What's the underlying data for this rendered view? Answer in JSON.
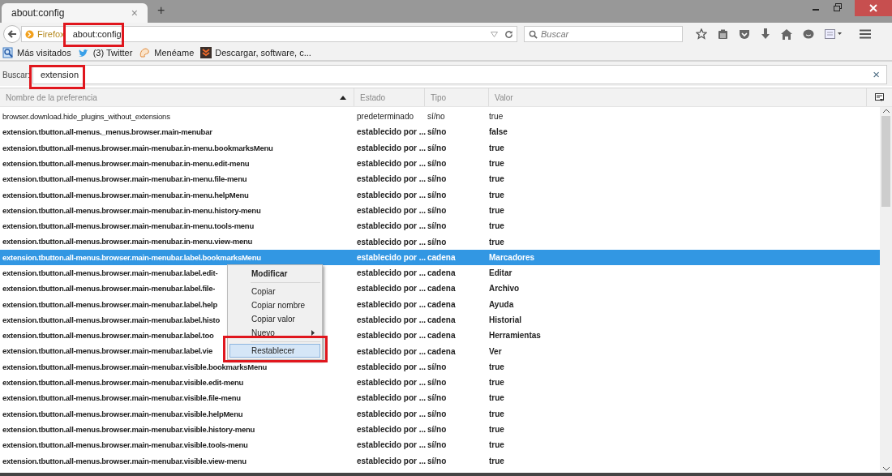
{
  "tab": {
    "title": "about:config",
    "close": "×",
    "new": "+"
  },
  "nav": {
    "identity": "Firefox",
    "url": "about:config",
    "search_placeholder": "Buscar"
  },
  "bookmarks": [
    {
      "label": "Más visitados",
      "kind": "mag"
    },
    {
      "label": "(3) Twitter",
      "kind": "bird"
    },
    {
      "label": "Menéame",
      "kind": "meneame"
    },
    {
      "label": "Descargar, software, c...",
      "kind": "download"
    }
  ],
  "filter": {
    "label": "Buscar:",
    "value": "extension",
    "clear": "×"
  },
  "table": {
    "columns": [
      {
        "label": "Nombre de la preferencia",
        "sorted": true
      },
      {
        "label": "Estado",
        "sorted": false
      },
      {
        "label": "Tipo",
        "sorted": false
      },
      {
        "label": "Valor",
        "sorted": false
      }
    ],
    "rows": [
      {
        "name": "browser.download.hide_plugins_without_extensions",
        "status": "predeterminado",
        "type": "sí/no",
        "value": "true",
        "modified": false,
        "selected": false
      },
      {
        "name": "extension.tbutton.all-menus._menus.browser.main-menubar",
        "status": "establecido por ...",
        "type": "sí/no",
        "value": "false",
        "modified": true,
        "selected": false
      },
      {
        "name": "extension.tbutton.all-menus.browser.main-menubar.in-menu.bookmarksMenu",
        "status": "establecido por ...",
        "type": "sí/no",
        "value": "true",
        "modified": true,
        "selected": false
      },
      {
        "name": "extension.tbutton.all-menus.browser.main-menubar.in-menu.edit-menu",
        "status": "establecido por ...",
        "type": "sí/no",
        "value": "true",
        "modified": true,
        "selected": false
      },
      {
        "name": "extension.tbutton.all-menus.browser.main-menubar.in-menu.file-menu",
        "status": "establecido por ...",
        "type": "sí/no",
        "value": "true",
        "modified": true,
        "selected": false
      },
      {
        "name": "extension.tbutton.all-menus.browser.main-menubar.in-menu.helpMenu",
        "status": "establecido por ...",
        "type": "sí/no",
        "value": "true",
        "modified": true,
        "selected": false
      },
      {
        "name": "extension.tbutton.all-menus.browser.main-menubar.in-menu.history-menu",
        "status": "establecido por ...",
        "type": "sí/no",
        "value": "true",
        "modified": true,
        "selected": false
      },
      {
        "name": "extension.tbutton.all-menus.browser.main-menubar.in-menu.tools-menu",
        "status": "establecido por ...",
        "type": "sí/no",
        "value": "true",
        "modified": true,
        "selected": false
      },
      {
        "name": "extension.tbutton.all-menus.browser.main-menubar.in-menu.view-menu",
        "status": "establecido por ...",
        "type": "sí/no",
        "value": "true",
        "modified": true,
        "selected": false
      },
      {
        "name": "extension.tbutton.all-menus.browser.main-menubar.label.bookmarksMenu",
        "status": "establecido por ...",
        "type": "cadena",
        "value": "Marcadores",
        "modified": true,
        "selected": true
      },
      {
        "name": "extension.tbutton.all-menus.browser.main-menubar.label.edit-",
        "status": "establecido por ...",
        "type": "cadena",
        "value": "Editar",
        "modified": true,
        "selected": false
      },
      {
        "name": "extension.tbutton.all-menus.browser.main-menubar.label.file-",
        "status": "establecido por ...",
        "type": "cadena",
        "value": "Archivo",
        "modified": true,
        "selected": false
      },
      {
        "name": "extension.tbutton.all-menus.browser.main-menubar.label.help",
        "status": "establecido por ...",
        "type": "cadena",
        "value": "Ayuda",
        "modified": true,
        "selected": false
      },
      {
        "name": "extension.tbutton.all-menus.browser.main-menubar.label.histo",
        "status": "establecido por ...",
        "type": "cadena",
        "value": "Historial",
        "modified": true,
        "selected": false
      },
      {
        "name": "extension.tbutton.all-menus.browser.main-menubar.label.too",
        "status": "establecido por ...",
        "type": "cadena",
        "value": "Herramientas",
        "modified": true,
        "selected": false
      },
      {
        "name": "extension.tbutton.all-menus.browser.main-menubar.label.vie",
        "status": "establecido por ...",
        "type": "cadena",
        "value": "Ver",
        "modified": true,
        "selected": false
      },
      {
        "name": "extension.tbutton.all-menus.browser.main-menubar.visible.bookmarksMenu",
        "status": "establecido por ...",
        "type": "sí/no",
        "value": "true",
        "modified": true,
        "selected": false
      },
      {
        "name": "extension.tbutton.all-menus.browser.main-menubar.visible.edit-menu",
        "status": "establecido por ...",
        "type": "sí/no",
        "value": "true",
        "modified": true,
        "selected": false
      },
      {
        "name": "extension.tbutton.all-menus.browser.main-menubar.visible.file-menu",
        "status": "establecido por ...",
        "type": "sí/no",
        "value": "true",
        "modified": true,
        "selected": false
      },
      {
        "name": "extension.tbutton.all-menus.browser.main-menubar.visible.helpMenu",
        "status": "establecido por ...",
        "type": "sí/no",
        "value": "true",
        "modified": true,
        "selected": false
      },
      {
        "name": "extension.tbutton.all-menus.browser.main-menubar.visible.history-menu",
        "status": "establecido por ...",
        "type": "sí/no",
        "value": "true",
        "modified": true,
        "selected": false
      },
      {
        "name": "extension.tbutton.all-menus.browser.main-menubar.visible.tools-menu",
        "status": "establecido por ...",
        "type": "sí/no",
        "value": "true",
        "modified": true,
        "selected": false
      },
      {
        "name": "extension.tbutton.all-menus.browser.main-menubar.visible.view-menu",
        "status": "establecido por ...",
        "type": "sí/no",
        "value": "true",
        "modified": true,
        "selected": false
      }
    ]
  },
  "context_menu": [
    {
      "label": "Modificar",
      "kind": "default",
      "selected": false
    },
    {
      "kind": "separator"
    },
    {
      "label": "Copiar",
      "kind": "item",
      "selected": false
    },
    {
      "label": "Copiar nombre",
      "kind": "item",
      "selected": false
    },
    {
      "label": "Copiar valor",
      "kind": "item",
      "selected": false
    },
    {
      "label": "Nuevo",
      "kind": "submenu",
      "selected": false
    },
    {
      "kind": "separator"
    },
    {
      "label": "Restablecer",
      "kind": "item",
      "selected": true
    }
  ]
}
